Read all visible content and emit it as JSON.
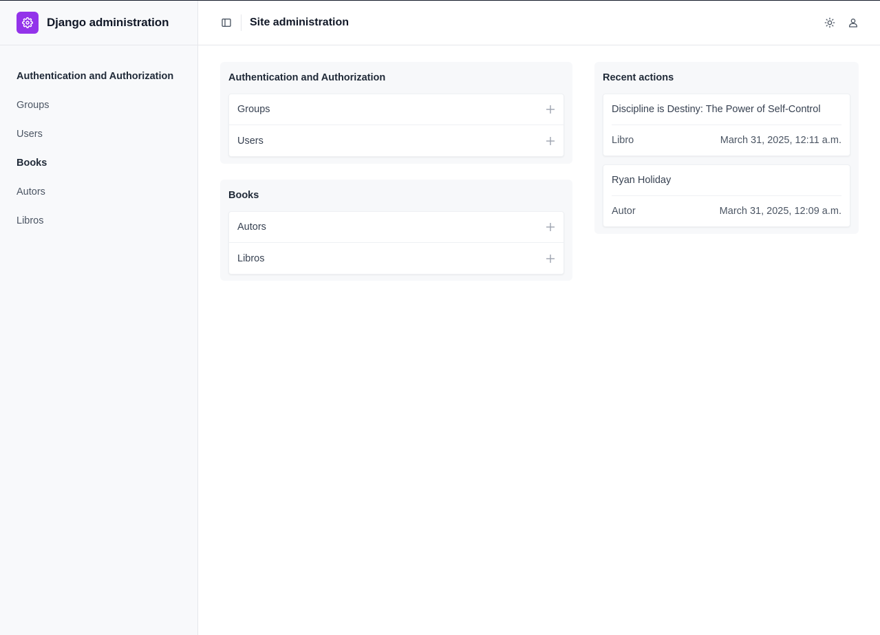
{
  "brand": {
    "title": "Django administration",
    "color": "#9333ea",
    "icon": "gear-icon"
  },
  "sidebar": {
    "sections": [
      {
        "title": "Authentication and Authorization",
        "items": [
          "Groups",
          "Users"
        ]
      },
      {
        "title": "Books",
        "items": [
          "Autors",
          "Libros"
        ]
      }
    ]
  },
  "header": {
    "title": "Site administration",
    "toggle_icon": "sidebar-toggle-icon",
    "actions": [
      "sun-icon",
      "user-icon"
    ]
  },
  "modules": [
    {
      "title": "Authentication and Authorization",
      "rows": [
        "Groups",
        "Users"
      ]
    },
    {
      "title": "Books",
      "rows": [
        "Autors",
        "Libros"
      ]
    }
  ],
  "recent": {
    "title": "Recent actions",
    "items": [
      {
        "name": "Discipline is Destiny: The Power of Self-Control",
        "type": "Libro",
        "date": "March 31, 2025, 12:11 a.m."
      },
      {
        "name": "Ryan Holiday",
        "type": "Autor",
        "date": "March 31, 2025, 12:09 a.m."
      }
    ]
  }
}
